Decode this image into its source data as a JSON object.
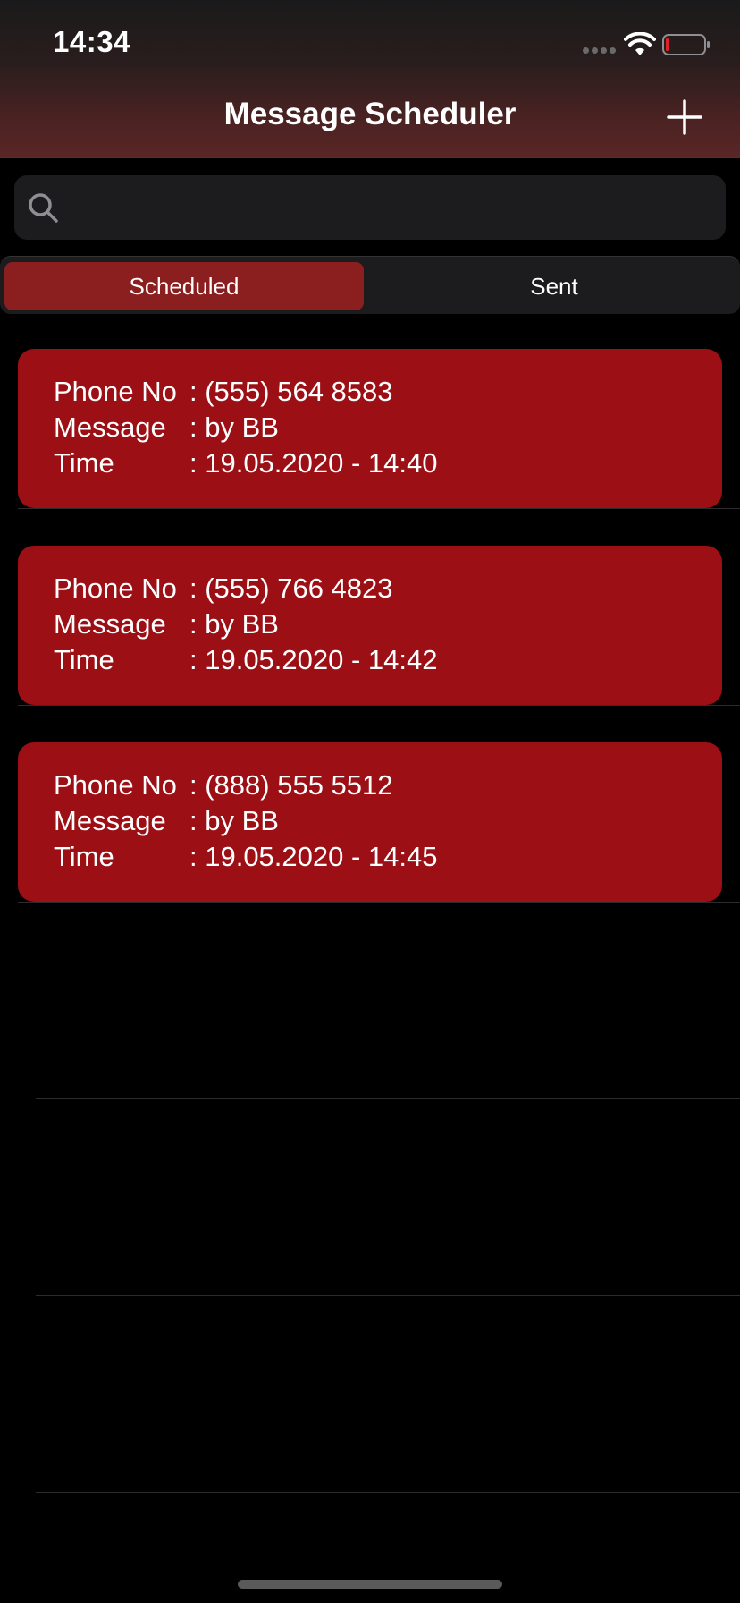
{
  "status_bar": {
    "time": "14:34",
    "icons": [
      "cellular-signal-icon",
      "wifi-icon",
      "battery-icon"
    ]
  },
  "nav": {
    "title": "Message Scheduler",
    "add_icon": "plus-icon"
  },
  "search": {
    "placeholder": "",
    "value": "",
    "icon": "search-icon"
  },
  "tabs": [
    {
      "label": "Scheduled",
      "selected": true
    },
    {
      "label": "Sent",
      "selected": false
    }
  ],
  "labels": {
    "phone": "Phone No",
    "message": "Message",
    "time": "Time"
  },
  "messages": [
    {
      "phone": ": (555) 564 8583",
      "message": ": by BB",
      "time": ": 19.05.2020 - 14:40"
    },
    {
      "phone": ": (555) 766 4823",
      "message": ": by BB",
      "time": ": 19.05.2020 - 14:42"
    },
    {
      "phone": ": (888) 555 5512",
      "message": ": by BB",
      "time": ": 19.05.2020 - 14:45"
    }
  ],
  "colors": {
    "accent": "#8b1e1e",
    "card": "#9b0f15",
    "background": "#000000"
  }
}
